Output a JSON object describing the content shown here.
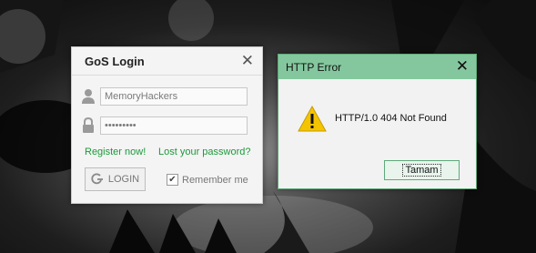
{
  "login_dialog": {
    "title": "GoS Login",
    "username_value": "MemoryHackers",
    "password_value": "•••••••••",
    "register_link": "Register now!",
    "lost_password_link": "Lost your password?",
    "login_button": "LOGIN",
    "remember_label": "Remember me",
    "remember_checked": true
  },
  "error_dialog": {
    "title": "HTTP Error",
    "message": "HTTP/1.0 404 Not Found",
    "ok_button": "Tamam"
  },
  "colors": {
    "link_green": "#1a9a3a",
    "error_titlebar": "#84c79e",
    "warning_yellow": "#f5c400"
  },
  "icons": {
    "username": "user-icon",
    "password": "lock-icon",
    "login": "power-icon",
    "warning": "warning-icon",
    "close": "close-icon"
  }
}
